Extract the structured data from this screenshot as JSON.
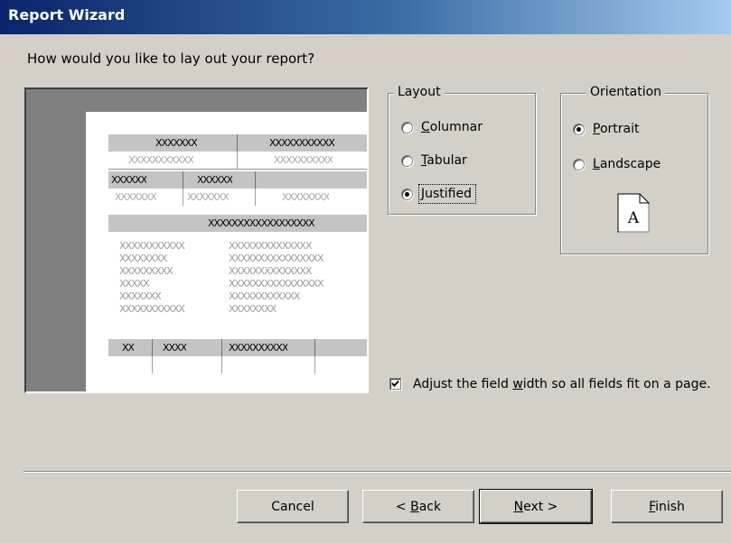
{
  "window": {
    "title": "Report Wizard"
  },
  "prompt": "How would you like to lay out your report?",
  "preview": {
    "row1_headers": [
      "XXXXXXX",
      "XXXXXXXXXXX"
    ],
    "row2_values": [
      "XXXXXXXXXXX",
      "XXXXXXXXXX"
    ],
    "row3_headers": [
      "XXXXXX",
      "XXXXXX"
    ],
    "row4_values": [
      "XXXXXXX",
      "XXXXXXX",
      "XXXXXXXX"
    ],
    "row5_header": "XXXXXXXXXXXXXXXXXX",
    "left_block": [
      "XXXXXXXXXXX",
      "XXXXXXXX",
      "XXXXXXXXX",
      "XXXXX",
      "XXXXXXX",
      "XXXXXXXXXXX"
    ],
    "right_block": [
      "XXXXXXXXXXXXXX",
      "XXXXXXXXXXXXXXXX",
      "XXXXXXXXXXXXXX",
      "XXXXXXXXXXXXXXXX",
      "XXXXXXXXXXXX",
      "XXXXXXXX"
    ],
    "bottom_headers": [
      "XX",
      "XXXX",
      "XXXXXXXXXX"
    ]
  },
  "layout": {
    "legend": "Layout",
    "options": [
      {
        "pre": "",
        "key": "C",
        "post": "olumnar",
        "selected": false
      },
      {
        "pre": "",
        "key": "T",
        "post": "abular",
        "selected": false
      },
      {
        "pre": "",
        "key": "J",
        "post": "ustified",
        "selected": true
      }
    ]
  },
  "orientation": {
    "legend": "Orientation",
    "options": [
      {
        "pre": "",
        "key": "P",
        "post": "ortrait",
        "selected": true
      },
      {
        "pre": "",
        "key": "L",
        "post": "andscape",
        "selected": false
      }
    ],
    "page_letter": "A"
  },
  "adjust": {
    "checked": true,
    "pre": "Adjust the field ",
    "key": "w",
    "post": "idth so all fields fit on a page."
  },
  "buttons": {
    "cancel": "Cancel",
    "back": {
      "pre": "< ",
      "key": "B",
      "post": "ack"
    },
    "next": {
      "pre": "",
      "key": "N",
      "post": "ext >"
    },
    "finish": {
      "pre": "",
      "key": "F",
      "post": "inish"
    }
  }
}
